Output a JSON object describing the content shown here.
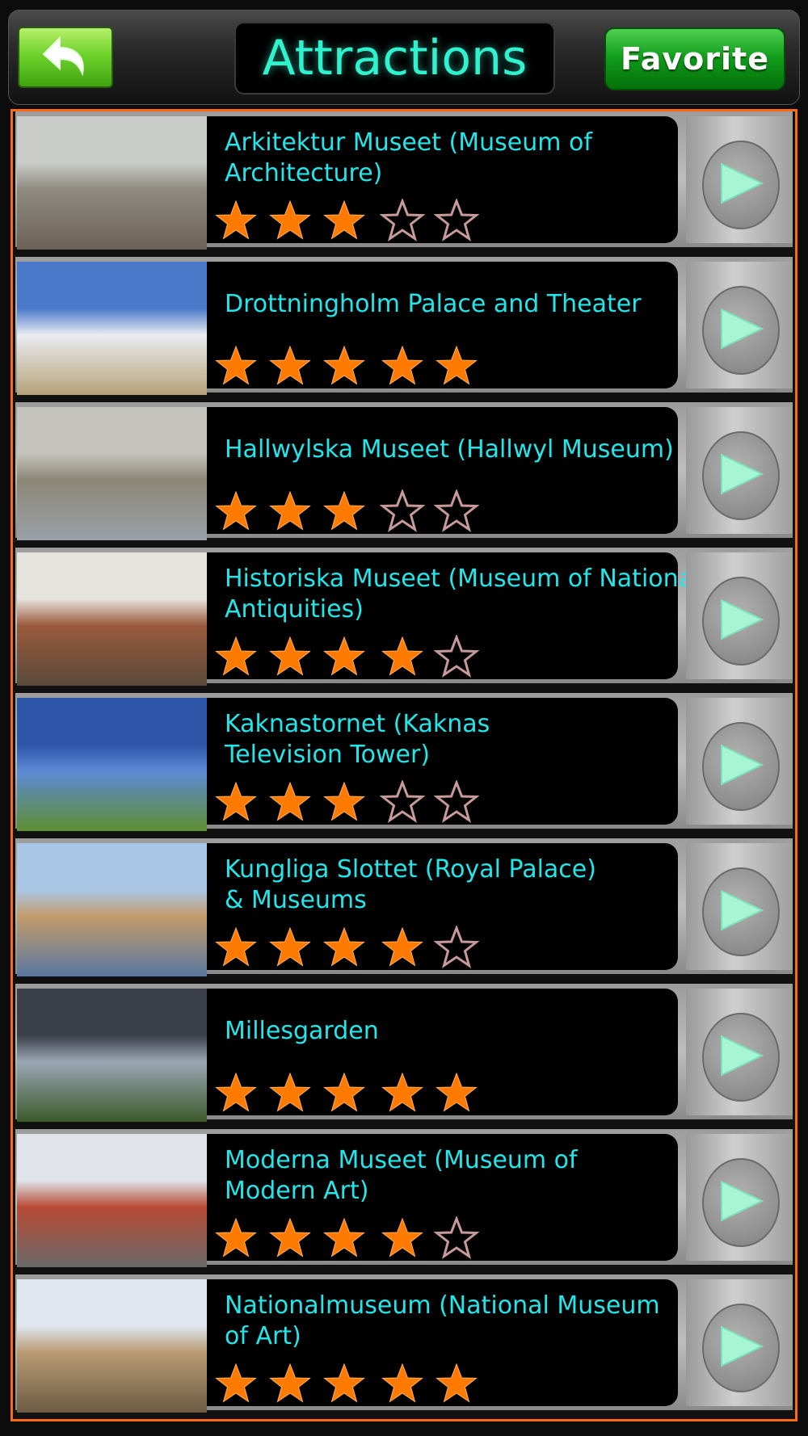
{
  "header": {
    "title": "Attractions",
    "favorite_label": "Favorite",
    "back_icon": "back-arrow-icon"
  },
  "colors": {
    "title_text": "#2ff3cf",
    "item_text": "#22e6ea",
    "star_filled": "#ff7a00",
    "list_border": "#ff6a10",
    "favorite_bg": "#0f9a1a",
    "back_bg": "#6fd22c"
  },
  "attractions": [
    {
      "name": "Arkitektur Museet (Museum of\nArchitecture)",
      "rating": 3
    },
    {
      "name": "Drottningholm Palace and Theater",
      "rating": 5
    },
    {
      "name": "Hallwylska Museet (Hallwyl Museum)",
      "rating": 3
    },
    {
      "name": "Historiska Museet (Museum of National\nAntiquities)",
      "rating": 4
    },
    {
      "name": "Kaknastornet (Kaknas\nTelevision Tower)",
      "rating": 3
    },
    {
      "name": "Kungliga Slottet (Royal Palace)\n& Museums",
      "rating": 4
    },
    {
      "name": "Millesgarden",
      "rating": 5
    },
    {
      "name": "Moderna Museet (Museum of\nModern Art)",
      "rating": 4
    },
    {
      "name": "Nationalmuseum (National Museum\nof Art)",
      "rating": 5
    }
  ],
  "max_rating": 5
}
